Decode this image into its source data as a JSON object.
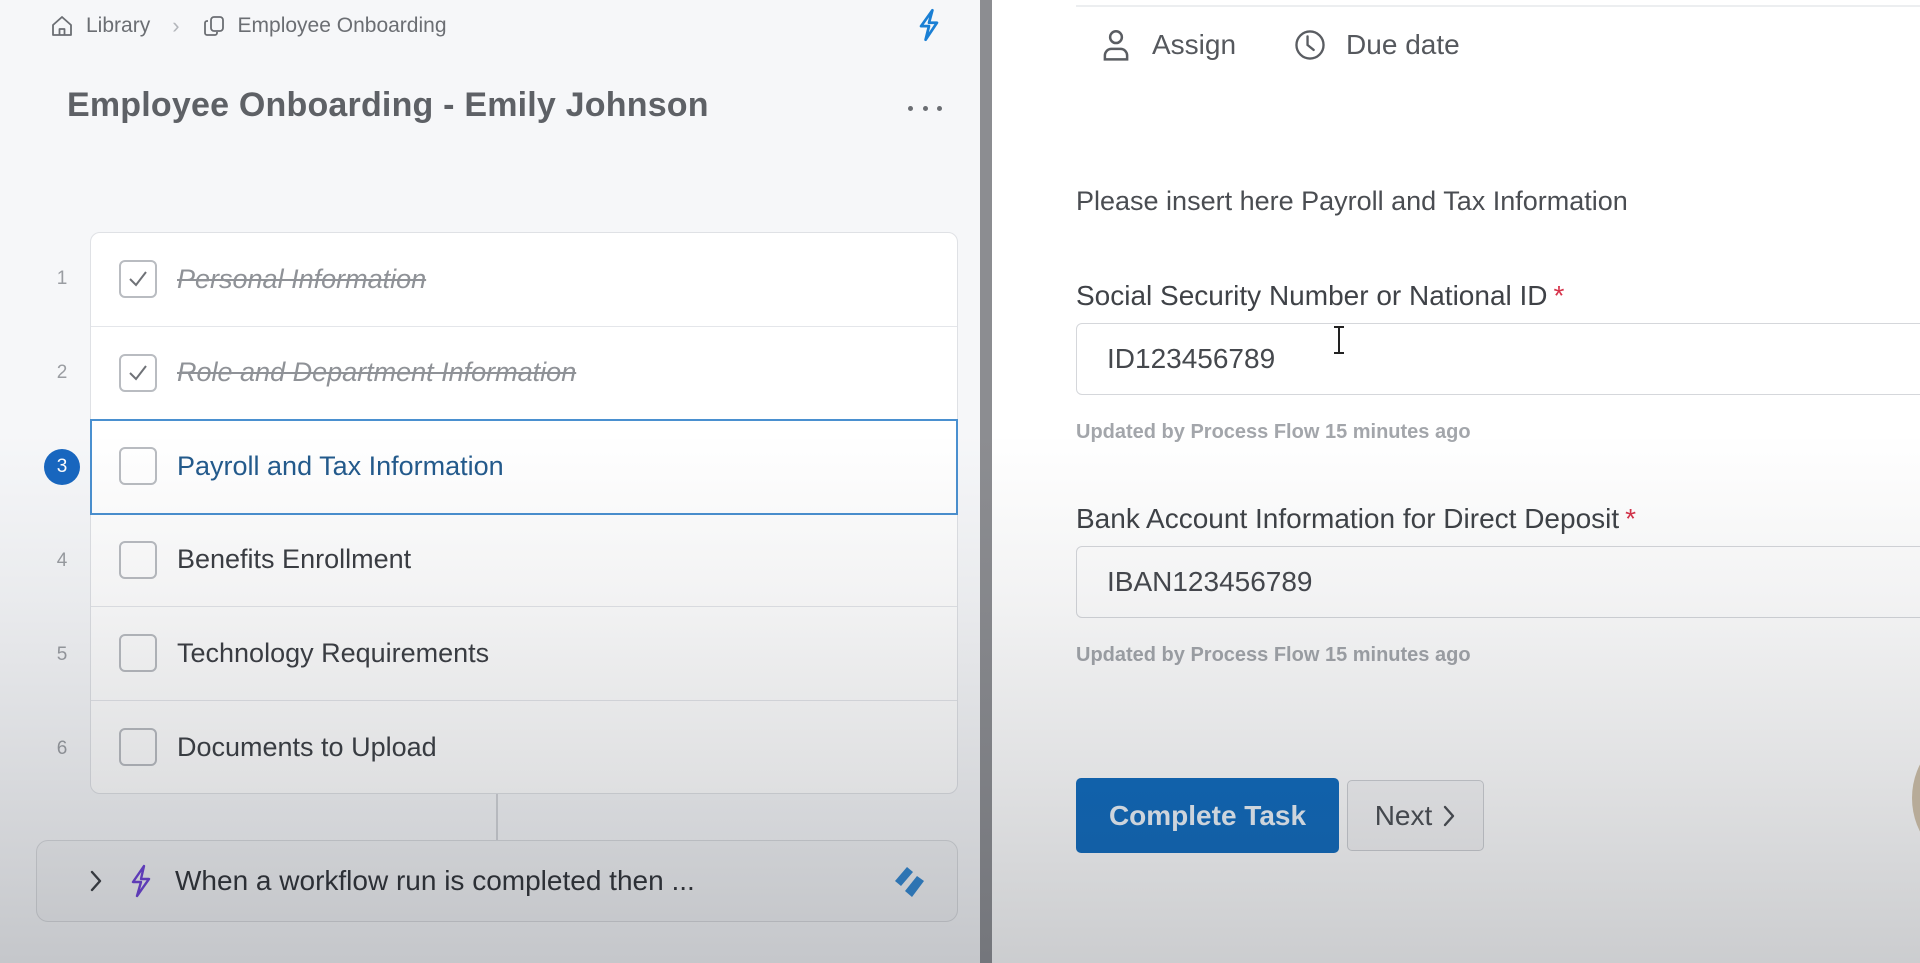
{
  "breadcrumb": {
    "items": [
      {
        "label": "Library",
        "icon": "home-icon"
      },
      {
        "label": "Employee Onboarding",
        "icon": "copy-icon"
      }
    ],
    "separator": "chevron-right-icon"
  },
  "header": {
    "title": "Employee Onboarding - Emily Johnson",
    "top_action_icon": "lightning-bolt-icon",
    "more_icon": "more-horizontal-icon"
  },
  "checklist": {
    "active_step": 3,
    "tasks": [
      {
        "number": "1",
        "label": "Personal Information",
        "completed": true
      },
      {
        "number": "2",
        "label": "Role and Department Information",
        "completed": true
      },
      {
        "number": "3",
        "label": "Payroll and Tax Information",
        "completed": false,
        "active": true
      },
      {
        "number": "4",
        "label": "Benefits Enrollment",
        "completed": false
      },
      {
        "number": "5",
        "label": "Technology Requirements",
        "completed": false
      },
      {
        "number": "6",
        "label": "Documents to Upload",
        "completed": false
      }
    ]
  },
  "workflow": {
    "text": "When a workflow run is completed then ...",
    "icon": "lightning-bolt-icon",
    "logo": "process-street-logo-icon"
  },
  "task_panel": {
    "actions": [
      {
        "label": "Assign",
        "icon": "user-icon"
      },
      {
        "label": "Due date",
        "icon": "clock-icon"
      }
    ],
    "instructions": "Please insert here Payroll and Tax Information",
    "fields": [
      {
        "label": "Social Security Number or National ID",
        "required": "*",
        "value": "ID123456789",
        "help": "Updated by Process Flow 15 minutes ago"
      },
      {
        "label": "Bank Account Information for Direct Deposit",
        "required": "*",
        "value": "IBAN123456789",
        "help": "Updated by Process Flow 15 minutes ago"
      }
    ],
    "complete_button": "Complete Task",
    "next_button": "Next"
  },
  "colors": {
    "primary": "#0d6abe",
    "active_badge": "#1867c0",
    "active_border": "#4a90d0",
    "required": "#d6334a",
    "bolt_blue": "#1a7fd4",
    "bolt_purple": "#6b3fd6"
  }
}
